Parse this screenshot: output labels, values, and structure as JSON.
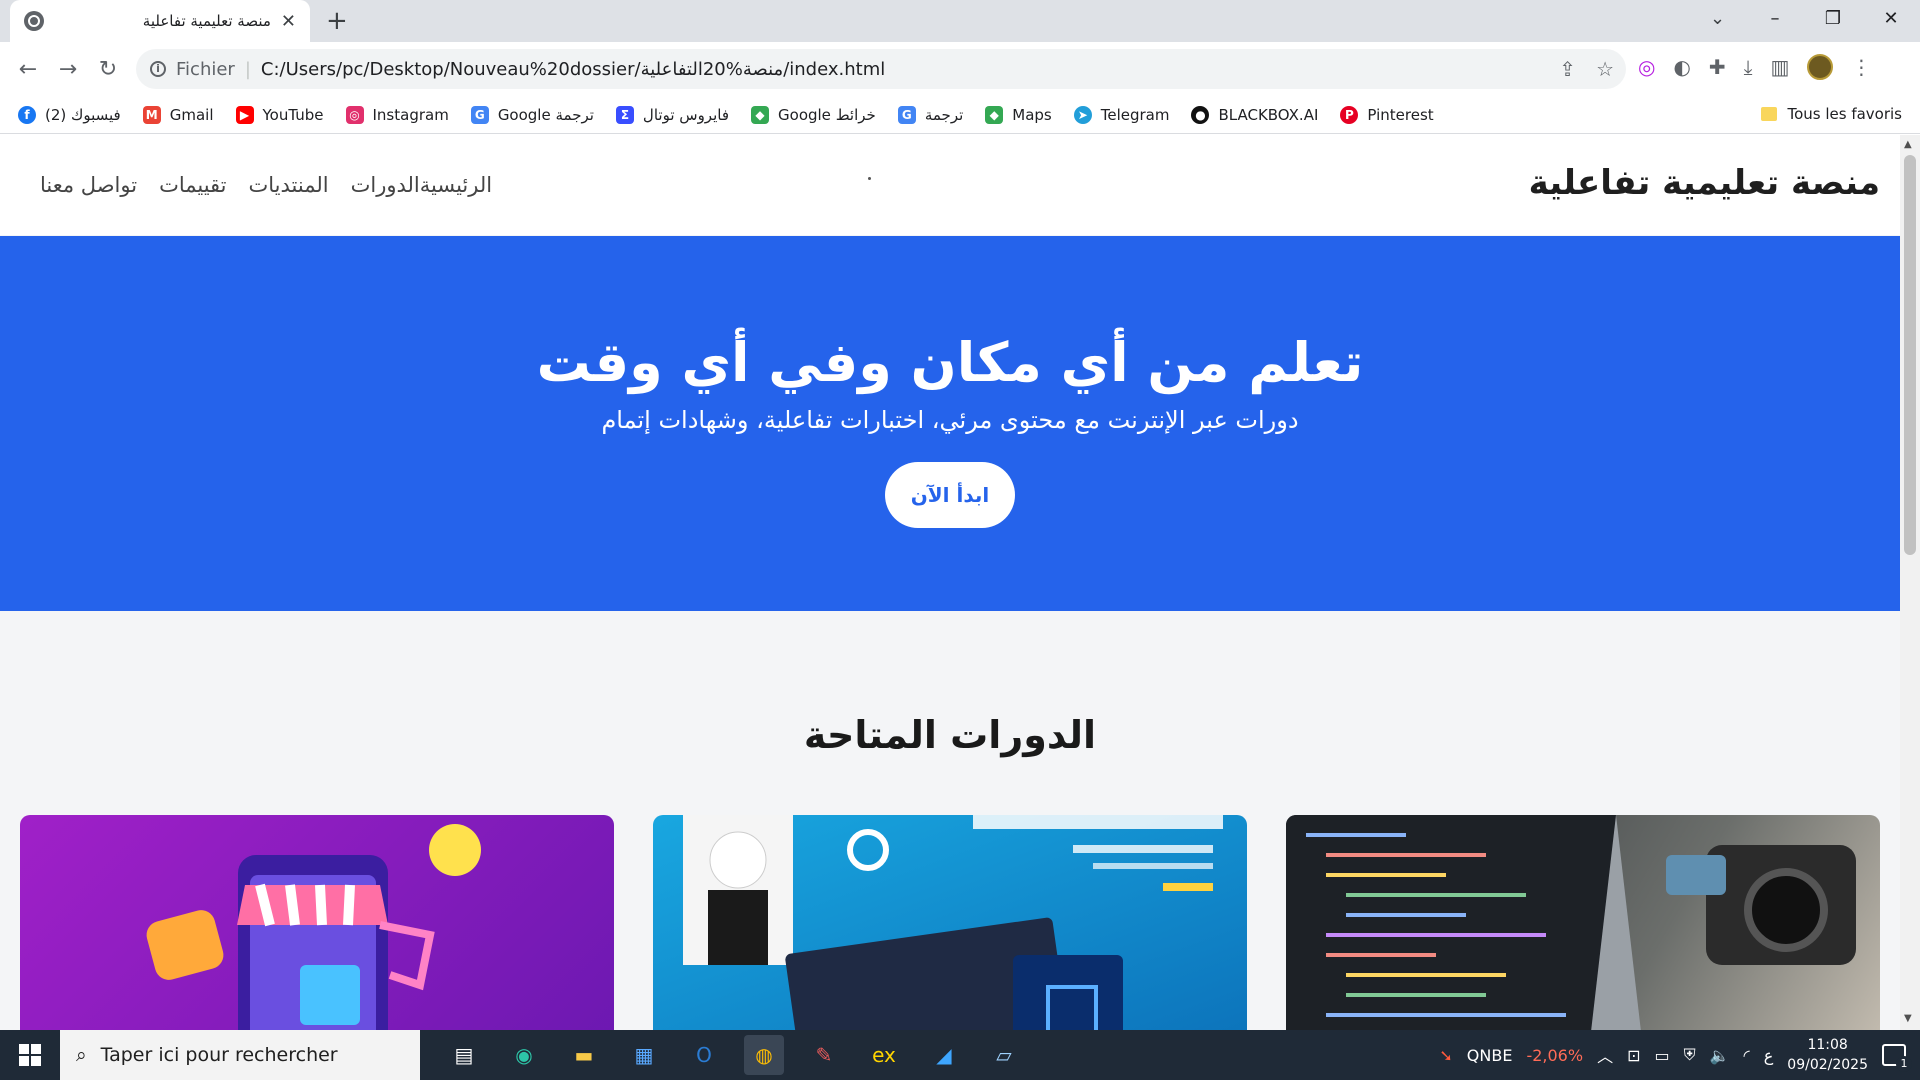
{
  "browser": {
    "tab_title": "منصة تعليمية تفاعلية",
    "omnibox_scheme": "Fichier",
    "url": "C:/Users/pc/Desktop/Nouveau%20dossier/منصة%20التفاعلية/index.html"
  },
  "bookmarks": {
    "items": [
      {
        "label": "(2) فيسبوك",
        "icon": "facebook-icon",
        "color": "#1877f2"
      },
      {
        "label": "Gmail",
        "icon": "gmail-icon",
        "color": "#ea4335"
      },
      {
        "label": "YouTube",
        "icon": "youtube-icon",
        "color": "#ff0000"
      },
      {
        "label": "Instagram",
        "icon": "instagram-icon",
        "color": "#e1306c"
      },
      {
        "label": "Google ترجمة",
        "icon": "translate-icon",
        "color": "#4285f4"
      },
      {
        "label": "فايروس توتال",
        "icon": "virustotal-icon",
        "color": "#394eff"
      },
      {
        "label": "Google خرائط",
        "icon": "maps-icon",
        "color": "#34a853"
      },
      {
        "label": "ترجمة",
        "icon": "translate-icon",
        "color": "#4285f4"
      },
      {
        "label": "Maps",
        "icon": "maps-icon",
        "color": "#34a853"
      },
      {
        "label": "Telegram",
        "icon": "telegram-icon",
        "color": "#229ed9"
      },
      {
        "label": "BLACKBOX.AI",
        "icon": "blackbox-icon",
        "color": "#111111"
      },
      {
        "label": "Pinterest",
        "icon": "pinterest-icon",
        "color": "#e60023"
      }
    ],
    "all_favorites": "Tous les favoris"
  },
  "site": {
    "logo": "منصة تعليمية تفاعلية",
    "nav": [
      "الرئيسيةالدورات",
      "المنتديات",
      "تقييمات",
      "تواصل معنا"
    ],
    "hero_title": "تعلم من أي مكان وفي أي وقت",
    "hero_subtitle": "دورات عبر الإنترنت مع محتوى مرئي، اختبارات تفاعلية، وشهادات إتمام",
    "hero_button": "ابدأ الآن",
    "courses_title": "الدورات المتاحة",
    "accent": "#2563eb"
  },
  "taskbar": {
    "search_placeholder": "Taper ici pour rechercher",
    "stock_name": "QNBE",
    "stock_change": "-2,06%",
    "time": "11:08",
    "date": "09/02/2025",
    "lang": "ع",
    "notif_count": "1"
  }
}
